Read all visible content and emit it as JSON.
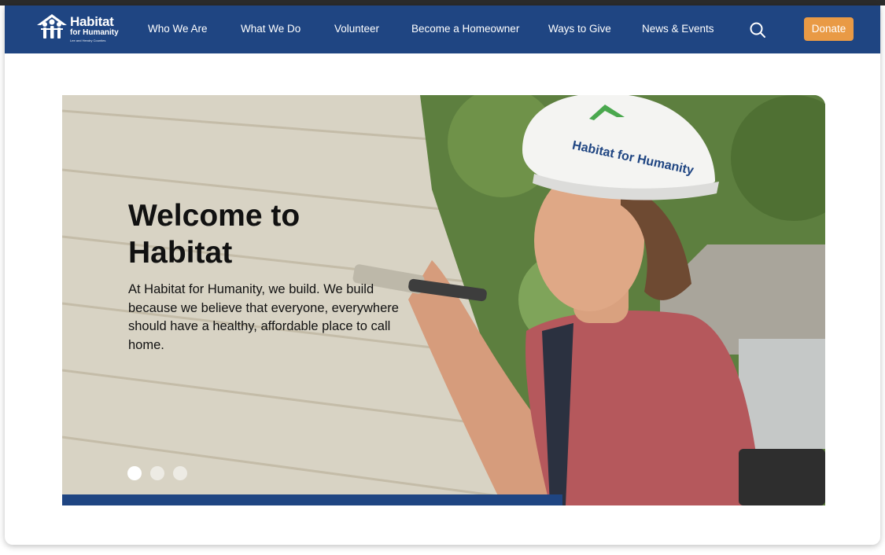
{
  "nav": {
    "logo": {
      "name": "Habitat",
      "sub": "for Humanity",
      "tagline": "Lee and Hendry Counties"
    },
    "items": [
      {
        "label": "Who We Are"
      },
      {
        "label": "What We Do"
      },
      {
        "label": "Volunteer"
      },
      {
        "label": "Become a Homeowner"
      },
      {
        "label": "Ways to Give"
      },
      {
        "label": "News & Events"
      }
    ],
    "search_icon": "search-icon",
    "donate_label": "Donate"
  },
  "hero": {
    "title": "Welcome to Habitat",
    "body": "At Habitat for Humanity, we build. We build because we believe that everyone, everywhere should have a healthy, affordable place to call home.",
    "helmet_text": "Habitat for Humanity",
    "slides": {
      "count": 3,
      "active": 1
    }
  },
  "colors": {
    "nav_bg": "#1f4582",
    "donate_bg": "#e99a45",
    "accent_bar": "#1f4582"
  }
}
